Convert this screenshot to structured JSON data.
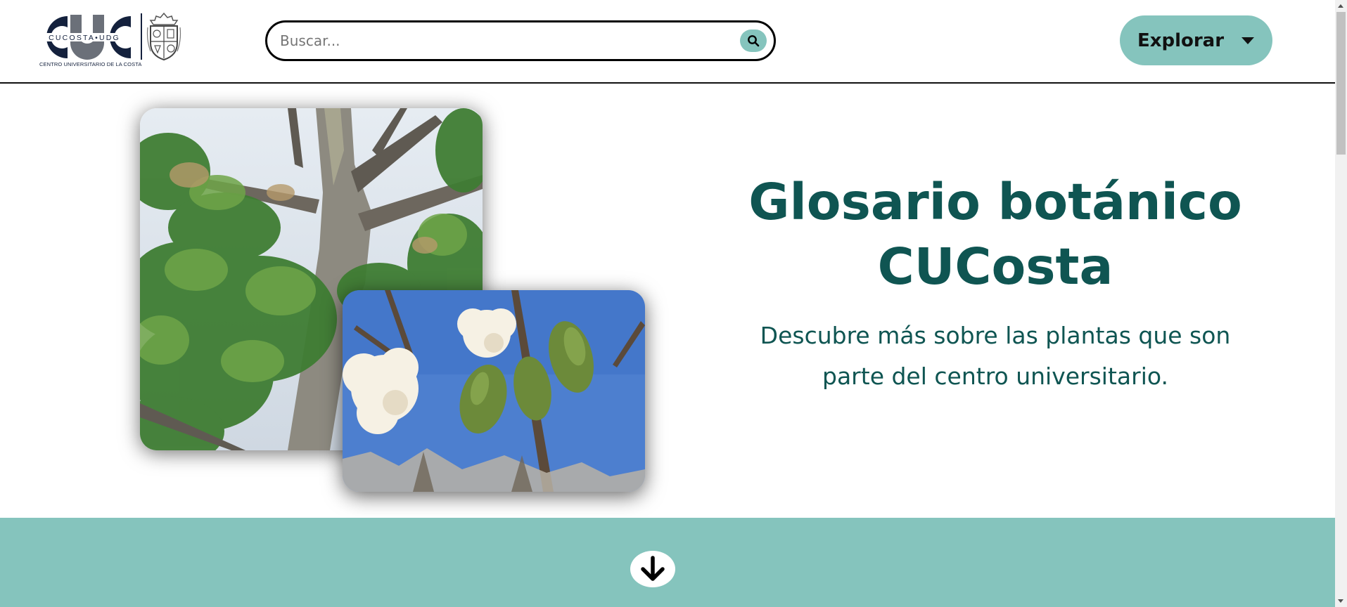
{
  "header": {
    "logo": {
      "letters": "CUC",
      "tagline": "CUCOSTA•UDG",
      "caption": "CENTRO UNIVERSITARIO DE LA COSTA"
    },
    "search": {
      "placeholder": "Buscar...",
      "value": "",
      "button_icon": "search-icon"
    },
    "explore": {
      "label": "Explorar",
      "icon": "caret-down-icon"
    }
  },
  "hero": {
    "title": "Glosario botánico CUCosta",
    "subtitle": "Descubre más sobre las plantas que son parte del centro universitario.",
    "images": [
      "tree-photo",
      "cotton-pods-photo"
    ]
  },
  "band": {
    "scroll_icon": "arrow-down-icon"
  },
  "colors": {
    "accent": "#85c4bd",
    "title": "#0f5552",
    "logo_navy": "#14213d"
  }
}
